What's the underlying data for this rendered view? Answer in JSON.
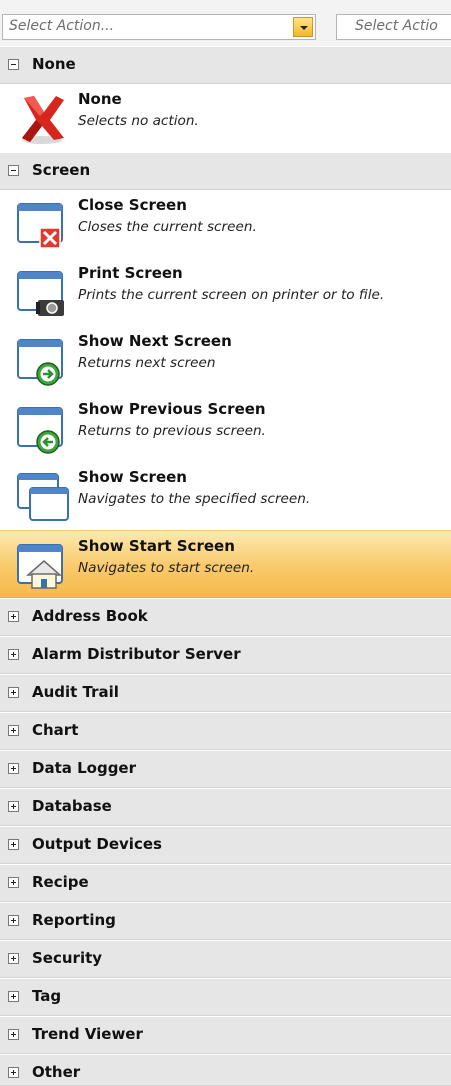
{
  "selects": {
    "primary_placeholder": "Select Action...",
    "secondary_placeholder": "Select Actio"
  },
  "categories": {
    "none": "None",
    "screen": "Screen",
    "collapsed": [
      "Address Book",
      "Alarm Distributor Server",
      "Audit Trail",
      "Chart",
      "Data Logger",
      "Database",
      "Output Devices",
      "Recipe",
      "Reporting",
      "Security",
      "Tag",
      "Trend Viewer",
      "Other"
    ]
  },
  "actions": {
    "none": {
      "title": "None",
      "desc": "Selects no action.",
      "icon": "red-x-icon"
    },
    "screen": [
      {
        "title": "Close Screen",
        "desc": "Closes the current screen.",
        "icon": "close-screen-icon"
      },
      {
        "title": "Print Screen",
        "desc": "Prints the current screen on printer or to file.",
        "icon": "print-screen-icon"
      },
      {
        "title": "Show Next Screen",
        "desc": "Returns next screen",
        "icon": "next-screen-icon"
      },
      {
        "title": "Show Previous Screen",
        "desc": "Returns to previous screen.",
        "icon": "previous-screen-icon"
      },
      {
        "title": "Show Screen",
        "desc": "Navigates to the specified screen.",
        "icon": "show-screen-icon"
      },
      {
        "title": "Show Start Screen",
        "desc": "Navigates to start screen.",
        "icon": "home-screen-icon",
        "selected": true
      }
    ]
  },
  "colors": {
    "header_bg": "#e6e6e6",
    "selected_gradient_top": "#fde9b0",
    "selected_gradient_bottom": "#f5b94c"
  }
}
